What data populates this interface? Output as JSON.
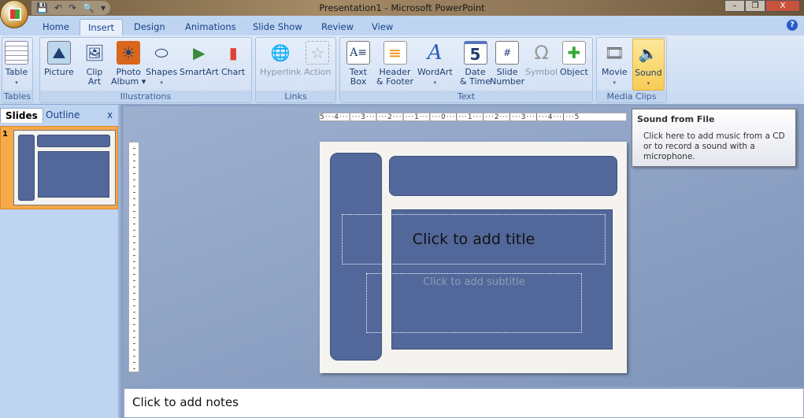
{
  "window": {
    "title": "Presentation1 - Microsoft PowerPoint",
    "minimize": "–",
    "restore": "❐",
    "close": "X"
  },
  "qat": {
    "save": "💾",
    "undo": "↶",
    "redo": "↷",
    "print_preview": "🔍",
    "customize": "▾"
  },
  "tabs": [
    "Home",
    "Insert",
    "Design",
    "Animations",
    "Slide Show",
    "Review",
    "View"
  ],
  "help": "?",
  "ribbon": {
    "groups": {
      "tables": "Tables",
      "illustrations": "Illustrations",
      "links": "Links",
      "text": "Text",
      "media": "Media Clips"
    },
    "table": [
      "Table",
      ""
    ],
    "picture": [
      "Picture",
      ""
    ],
    "clipart": [
      "Clip",
      "Art"
    ],
    "photo": [
      "Photo",
      "Album ▾"
    ],
    "shapes": [
      "Shapes",
      ""
    ],
    "smartart": [
      "SmartArt",
      ""
    ],
    "chart": [
      "Chart",
      ""
    ],
    "hyperlink": [
      "Hyperlink",
      ""
    ],
    "action": [
      "Action",
      ""
    ],
    "textbox": [
      "Text",
      "Box"
    ],
    "header": [
      "Header",
      "& Footer"
    ],
    "wordart": [
      "WordArt",
      ""
    ],
    "datetime": [
      "Date",
      "& Time"
    ],
    "slidenum": [
      "Slide",
      "Number"
    ],
    "symbol": [
      "Symbol",
      ""
    ],
    "object": [
      "Object",
      ""
    ],
    "movie": [
      "Movie",
      ""
    ],
    "sound": [
      "Sound",
      ""
    ]
  },
  "pane": {
    "tab_slides": "Slides",
    "tab_outline": "Outline",
    "close": "x",
    "slide_number": "1"
  },
  "ruler": {
    "horizontal": "5···4···|···3···|···2···|···1···|···0···|···1···|···2···|···3···|···4···|···5"
  },
  "slide": {
    "title_placeholder": "Click to add title",
    "subtitle_placeholder": "Click to add subtitle"
  },
  "notes": {
    "placeholder": "Click to add notes"
  },
  "tooltip": {
    "title": "Sound from File",
    "body": "Click here to add music from a CD or to record a sound with a microphone."
  }
}
